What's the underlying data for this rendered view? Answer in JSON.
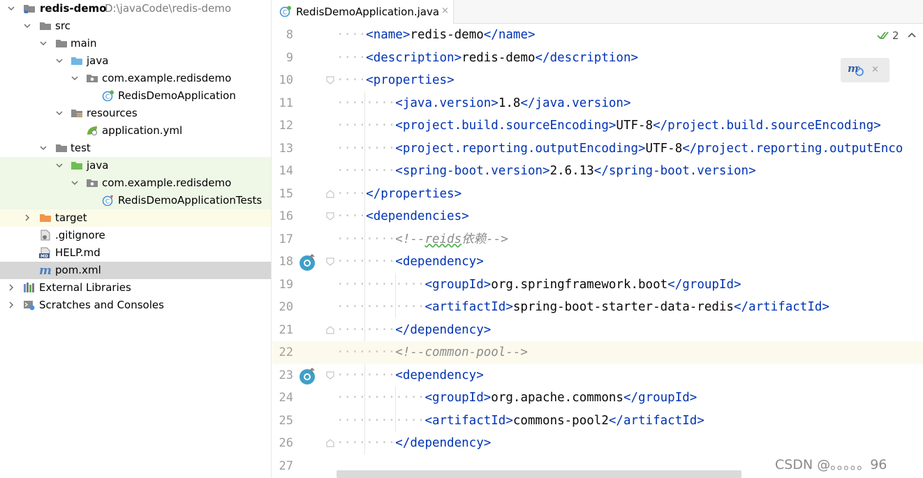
{
  "project_tree": {
    "project_name": "redis-demo",
    "project_path": "D:\\javaCode\\redis-demo",
    "items": [
      {
        "label": "redis-demo"
      },
      {
        "label": "src"
      },
      {
        "label": "main"
      },
      {
        "label": "java"
      },
      {
        "label": "com.example.redisdemo"
      },
      {
        "label": "RedisDemoApplication"
      },
      {
        "label": "resources"
      },
      {
        "label": "application.yml"
      },
      {
        "label": "test"
      },
      {
        "label": "java"
      },
      {
        "label": "com.example.redisdemo"
      },
      {
        "label": "RedisDemoApplicationTests"
      },
      {
        "label": "target"
      },
      {
        "label": ".gitignore"
      },
      {
        "label": "HELP.md"
      },
      {
        "label": "pom.xml"
      },
      {
        "label": "External Libraries"
      },
      {
        "label": "Scratches and Consoles"
      }
    ]
  },
  "editor": {
    "tab_label": "RedisDemoApplication.java",
    "tab_close": "×",
    "inspection_count": "2",
    "maven_popup_close": "×",
    "lines": [
      {
        "num": "8"
      },
      {
        "num": "9"
      },
      {
        "num": "10"
      },
      {
        "num": "11"
      },
      {
        "num": "12"
      },
      {
        "num": "13"
      },
      {
        "num": "14"
      },
      {
        "num": "15"
      },
      {
        "num": "16"
      },
      {
        "num": "17"
      },
      {
        "num": "18"
      },
      {
        "num": "19"
      },
      {
        "num": "20"
      },
      {
        "num": "21"
      },
      {
        "num": "22"
      },
      {
        "num": "23"
      },
      {
        "num": "24"
      },
      {
        "num": "25"
      },
      {
        "num": "26"
      },
      {
        "num": "27"
      }
    ],
    "code": {
      "l8": {
        "tag": "name",
        "value": "redis-demo"
      },
      "l9": {
        "tag": "description",
        "value": "redis-demo"
      },
      "l10": {
        "tag": "properties"
      },
      "l11": {
        "tag": "java.version",
        "value": "1.8"
      },
      "l12": {
        "tag": "project.build.sourceEncoding",
        "value": "UTF-8"
      },
      "l13": {
        "tag": "project.reporting.outputEncoding",
        "value": "UTF-8",
        "close_visible": "project.reporting.outputEnco"
      },
      "l14": {
        "tag": "spring-boot.version",
        "value": "2.6.13"
      },
      "l15": {
        "tag": "properties"
      },
      "l16": {
        "tag": "dependencies"
      },
      "l17": {
        "comment_open": "<!--",
        "comment_word": "reids",
        "comment_rest": "依赖-->"
      },
      "l18": {
        "tag": "dependency"
      },
      "l19": {
        "tag": "groupId",
        "value": "org.springframework.boot"
      },
      "l20": {
        "tag": "artifactId",
        "value": "spring-boot-starter-data-redis"
      },
      "l21": {
        "tag": "dependency"
      },
      "l22": {
        "comment": "<!--common-pool-->"
      },
      "l23": {
        "tag": "dependency"
      },
      "l24": {
        "tag": "groupId",
        "value": "org.apache.commons"
      },
      "l25": {
        "tag": "artifactId",
        "value": "commons-pool2"
      },
      "l26": {
        "tag": "dependency"
      }
    }
  },
  "watermark": "CSDN @。。。。。96",
  "colors": {
    "tag": "#0033b3",
    "text": "#080808",
    "comment": "#8c8c8c",
    "line_number": "#9e9e9e",
    "test_bg": "#eff7e7",
    "excluded_bg": "#fbfbe7",
    "selected_bg": "#d6d6d6",
    "current_line_bg": "#fcfaed"
  },
  "icons": {
    "arrow_expanded": "chevron-down-icon",
    "arrow_collapsed": "chevron-right-icon",
    "project_folder": "module-folder-icon",
    "folder": "folder-icon",
    "source_root": "source-root-icon",
    "package": "package-icon",
    "java_class": "spring-boot-class-icon",
    "resources": "resources-folder-icon",
    "yml": "spring-yml-icon",
    "test_root": "test-root-icon",
    "test_class": "test-class-icon",
    "excluded": "excluded-folder-icon",
    "gitignore": "gitignore-icon",
    "markdown": "markdown-icon",
    "maven": "maven-icon",
    "libraries": "libraries-icon",
    "scratches": "scratches-icon",
    "gutter_override": "overridden-method-icon"
  }
}
